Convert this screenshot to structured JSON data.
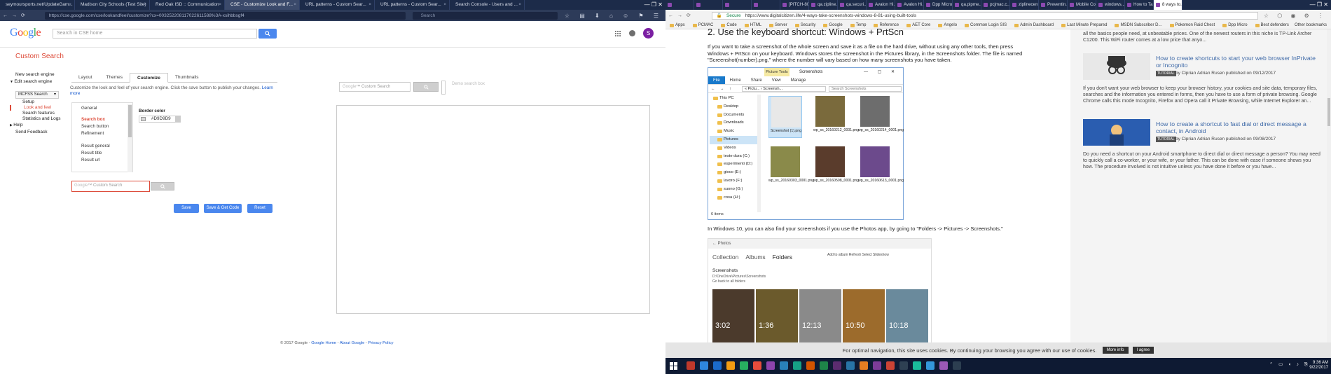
{
  "left_browser": {
    "tabs": [
      {
        "label": "seymoursports.net/UpdateGam...",
        "active": false
      },
      {
        "label": "Madison City Schools (Test Site)",
        "active": false
      },
      {
        "label": "Red Oak ISD :: Communication",
        "active": false
      },
      {
        "label": "CSE - Customize Look and F...",
        "active": true
      },
      {
        "label": "URL patterns - Custom Sear...",
        "active": false
      },
      {
        "label": "URL patterns - Custom Sear...",
        "active": false
      },
      {
        "label": "Search Console - Users and ...",
        "active": false
      }
    ],
    "url": "https://cse.google.com/cse/lookandfeel/customize?cx=003252208117022611588%3A-xsihbbsgf4",
    "search_placeholder": "Search",
    "google_logo": "Google",
    "search_box_placeholder": "Search in CSE home",
    "avatar_letter": "S",
    "cse": {
      "title": "Custom Search",
      "sidebar": {
        "new_engine": "New search engine",
        "edit_engine": "Edit search engine",
        "engine_select": "MCFSS Search",
        "setup": "Setup",
        "look_and_feel": "Look and feel",
        "search_features": "Search features",
        "statistics": "Statistics and Logs",
        "help": "Help",
        "send_feedback": "Send Feedback"
      },
      "tabs": [
        {
          "label": "Layout",
          "active": false
        },
        {
          "label": "Themes",
          "active": false
        },
        {
          "label": "Customize",
          "active": true
        },
        {
          "label": "Thumbnails",
          "active": false
        }
      ],
      "description": "Customize the look and feel of your search engine. Click the save button to publish your changes.",
      "learn_more": "Learn more",
      "panel_items": {
        "general": "General",
        "search_box": "Search box",
        "search_button": "Search button",
        "refinement": "Refinement",
        "result_general": "Result general",
        "result_title": "Result title",
        "result_url": "Result url"
      },
      "border_color_label": "Border color",
      "border_color_value": "#D9D9D9",
      "preview_placeholder": "Custom Search",
      "preview_google_mark": "Google",
      "buttons": {
        "save": "Save",
        "save_get_code": "Save & Get Code",
        "reset": "Reset"
      },
      "preview_search_placeholder": "Custom Search",
      "preview_hint": "Demo search box",
      "footer": {
        "copyright": "© 2017 Google - ",
        "google_home": "Google Home",
        "about": "About Google",
        "privacy": "Privacy Policy",
        "sep": " - "
      }
    }
  },
  "right_browser": {
    "tabs": [
      {
        "label": "",
        "active": false
      },
      {
        "label": "",
        "active": false
      },
      {
        "label": "",
        "active": false
      },
      {
        "label": "",
        "active": false
      },
      {
        "label": "[PITCH-80...",
        "active": false
      },
      {
        "label": "qa.zipline...",
        "active": false
      },
      {
        "label": "qa.securi...",
        "active": false
      },
      {
        "label": "Avalon Hi...",
        "active": false
      },
      {
        "label": "Avalon Hi...",
        "active": false
      },
      {
        "label": "Dpp Micro...",
        "active": false
      },
      {
        "label": "qa.pipme...",
        "active": false
      },
      {
        "label": "pcjmac.c...",
        "active": false
      },
      {
        "label": "ziplinecen...",
        "active": false
      },
      {
        "label": "Preventin...",
        "active": false
      },
      {
        "label": "Mobile Co...",
        "active": false
      },
      {
        "label": "windows...",
        "active": false
      },
      {
        "label": "How to Ta...",
        "active": false
      },
      {
        "label": "8 ways to...",
        "active": true
      }
    ],
    "url_secure": "Secure",
    "url": "https://www.digitalcitizen.life/4-ways-take-screenshots-windows-8-81-using-built-tools",
    "bookmarks": [
      "Apps",
      "PCMAC",
      "Code",
      "HTML",
      "Server",
      "Security",
      "Google",
      "Temp",
      "Reference",
      "AET Core",
      "Angelo",
      "Common Login SIS",
      "Admin Dashboard",
      "Last Minute Prepared",
      "MSDN Subscriber D...",
      "Pokemon Raid Chest",
      "Dpp Micro",
      "Best defenders"
    ],
    "bookmarks_other": "Other bookmarks",
    "article": {
      "heading": "2. Use the keyboard shortcut: Windows + PrtScn",
      "paragraph1": "If you want to take a screenshot of the whole screen and save it as a file on the hard drive, without using any other tools, then press Windows + PrtScn on your keyboard. Windows stores the screenshot in the Pictures library, in the Screenshots folder. The file is named \"Screenshot(number).png,\" where the number will vary based on how many screenshots you have taken.",
      "paragraph2": "In Windows 10, you can also find your screenshots if you use the Photos app, by going to \"Folders -> Pictures -> Screenshots.\""
    },
    "explorer": {
      "title": "Screenshots",
      "picture_tools": "Picture Tools",
      "ribbon": [
        "File",
        "Home",
        "Share",
        "View",
        "Manage"
      ],
      "address": "« Pictu... › Screensh...",
      "search_placeholder": "Search Screenshots",
      "tree": [
        {
          "label": "This PC",
          "sub": false,
          "sel": false
        },
        {
          "label": "Desktop",
          "sub": true,
          "sel": false
        },
        {
          "label": "Documents",
          "sub": true,
          "sel": false
        },
        {
          "label": "Downloads",
          "sub": true,
          "sel": false
        },
        {
          "label": "Music",
          "sub": true,
          "sel": false
        },
        {
          "label": "Pictures",
          "sub": true,
          "sel": true
        },
        {
          "label": "Videos",
          "sub": true,
          "sel": false
        },
        {
          "label": "teste dura (C:)",
          "sub": true,
          "sel": false
        },
        {
          "label": "esperimenti (D:)",
          "sub": true,
          "sel": false
        },
        {
          "label": "gioco (E:)",
          "sub": true,
          "sel": false
        },
        {
          "label": "lavoro (F:)",
          "sub": true,
          "sel": false
        },
        {
          "label": "suono (G:)",
          "sub": true,
          "sel": false
        },
        {
          "label": "cosa (H:)",
          "sub": true,
          "sel": false
        }
      ],
      "status": "6 items",
      "files": [
        {
          "name": "Screenshot (1).png",
          "color": "#e8e8e8",
          "sel": true
        },
        {
          "name": "wp_ss_20160212_0001.png",
          "color": "#7a6a3c",
          "sel": false
        },
        {
          "name": "wp_ss_20160214_0001.png",
          "color": "#6d6d6d",
          "sel": false
        },
        {
          "name": "wp_ss_20160303_0001.png",
          "color": "#8a8a4a",
          "sel": false
        },
        {
          "name": "wp_ss_20160508_0001.png",
          "color": "#5a3c2c",
          "sel": false
        },
        {
          "name": "wp_ss_20160613_0001.png",
          "color": "#6c4a8c",
          "sel": false
        }
      ]
    },
    "photos": {
      "app": "Photos",
      "nav": [
        "Collection",
        "Albums",
        "Folders"
      ],
      "tools": "Add to album   Refresh   Select   Slideshow",
      "heading": "Screenshots",
      "path": "D:\\OneDrive\\Pictures\\Screenshots",
      "back": "Go back to all folders",
      "tiles": [
        {
          "time": "3:02",
          "color": "#4b3a2c"
        },
        {
          "time": "1:36",
          "color": "#6b5a2c"
        },
        {
          "time": "12:13",
          "color": "#8a8a8a"
        },
        {
          "time": "10:50",
          "color": "#9c6b2c"
        },
        {
          "time": "10:18",
          "color": "#6a8a9c"
        }
      ]
    },
    "related": {
      "top_text": "all the basics people need, at unbeatable prices. One of the newest routers in this niche is TP-Link Archer C1200. This WiFi router comes at a low price that anyo...",
      "item1_title": "How to create shortcuts to start your web browser InPrivate or Incognito",
      "item1_badge": "TUTORIAL",
      "item1_meta": "by Ciprian Adrian Rusen published on 09/12/2017",
      "item1_text": "If you don't want your web browser to keep your browser history, your cookies and site data, temporary files, searches and the information you entered in forms, then you have to use a form of private browsing. Google Chrome calls this mode Incognito, Firefox and Opera call it Private Browsing, while Internet Explorer an...",
      "item2_title": "How to create a shortcut to fast dial or direct message a contact, in Android",
      "item2_badge": "TUTORIAL",
      "item2_meta": "by Ciprian Adrian Rusen published on 09/08/2017",
      "item2_text": "Do you need a shortcut on your Android smartphone to direct dial or direct message a person? You may need to quickly call a co-worker, or your wife, or your father. This can be done with ease if someone shows you how. The procedure involved is not intuitive unless you have done it before or you have..."
    },
    "cookie": {
      "text": "For optimal navigation, this site uses cookies. By continuing your browsing you agree with our use of cookies.",
      "more_info": "More info",
      "agree": "I agree"
    }
  },
  "taskbar": {
    "clock_time": "9:36 AM",
    "clock_date": "9/22/2017",
    "icon_colors": [
      "#c0392b",
      "#2e86de",
      "#1b6ac9",
      "#f39c12",
      "#27ae60",
      "#e74c3c",
      "#8e44ad",
      "#2980b9",
      "#16a085",
      "#d35400",
      "#1e8449",
      "#5b2c6f",
      "#2874a6",
      "#e67e22",
      "#7d3c98",
      "#cb4335",
      "#2e4053",
      "#1abc9c",
      "#3498db",
      "#9b59b6",
      "#2c3e50"
    ]
  }
}
